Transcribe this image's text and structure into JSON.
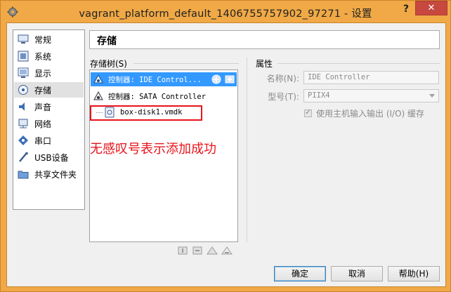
{
  "window": {
    "title": "vagrant_platform_default_1406755757902_97271 - 设置",
    "help_label": "?",
    "close_label": "✕"
  },
  "sidebar": {
    "items": [
      {
        "label": "常规",
        "icon": "general-icon"
      },
      {
        "label": "系统",
        "icon": "system-icon"
      },
      {
        "label": "显示",
        "icon": "display-icon"
      },
      {
        "label": "存储",
        "icon": "storage-icon",
        "selected": true
      },
      {
        "label": "声音",
        "icon": "audio-icon"
      },
      {
        "label": "网络",
        "icon": "network-icon"
      },
      {
        "label": "串口",
        "icon": "serial-port-icon"
      },
      {
        "label": "USB设备",
        "icon": "usb-icon"
      },
      {
        "label": "共享文件夹",
        "icon": "shared-folder-icon"
      }
    ]
  },
  "header": {
    "title": "存储"
  },
  "storage_tree": {
    "label": "存储树(S)",
    "rows": [
      {
        "text": "控制器: IDE Control...",
        "selected": true,
        "icon": "ide-controller-icon"
      },
      {
        "text": "控制器: SATA Controller",
        "icon": "sata-controller-icon"
      },
      {
        "text": "box-disk1.vmdk",
        "icon": "disk-icon"
      }
    ]
  },
  "annotation": {
    "text": "无感叹号表示添加成功"
  },
  "attributes": {
    "label": "属性",
    "name_label": "名称(N):",
    "name_value": "IDE Controller",
    "type_label": "型号(T):",
    "type_value": "PIIX4",
    "host_cache_label": "使用主机输入输出 (I/O) 缓存",
    "host_cache_checked": true
  },
  "buttons": {
    "ok": "确定",
    "cancel": "取消",
    "help": "帮助(H)"
  },
  "colors": {
    "frame": "#f0a946",
    "selection": "#3399ff",
    "annotation": "#e8131b"
  }
}
